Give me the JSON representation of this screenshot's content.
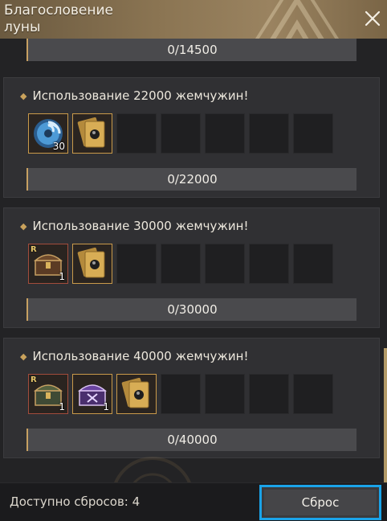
{
  "window": {
    "title": "Благословение\nлуны"
  },
  "top_progress": "0/14500",
  "cards": [
    {
      "title": "Использование 22000 жемчужин!",
      "progress": "0/22000",
      "rewards": [
        {
          "icon": "moon-orb-icon",
          "count": "30"
        },
        {
          "icon": "gold-ticket-icon",
          "count": ""
        }
      ]
    },
    {
      "title": "Использование 30000 жемчужин!",
      "progress": "0/30000",
      "rewards": [
        {
          "icon": "treasure-chest-icon",
          "rank": "R",
          "count": "1"
        },
        {
          "icon": "gold-ticket-icon",
          "count": ""
        }
      ]
    },
    {
      "title": "Использование 40000 жемчужин!",
      "progress": "0/40000",
      "rewards": [
        {
          "icon": "treasure-chest-icon",
          "rank": "R",
          "count": "1"
        },
        {
          "icon": "purple-chest-icon",
          "count": "1"
        },
        {
          "icon": "gold-ticket-icon",
          "count": ""
        }
      ]
    }
  ],
  "footer": {
    "resets_label": "Доступно сбросов: 4",
    "reset_button": "Сброс"
  },
  "colors": {
    "accent": "#1aa3e8",
    "gold": "#c7a062",
    "header": "#8a7452"
  }
}
